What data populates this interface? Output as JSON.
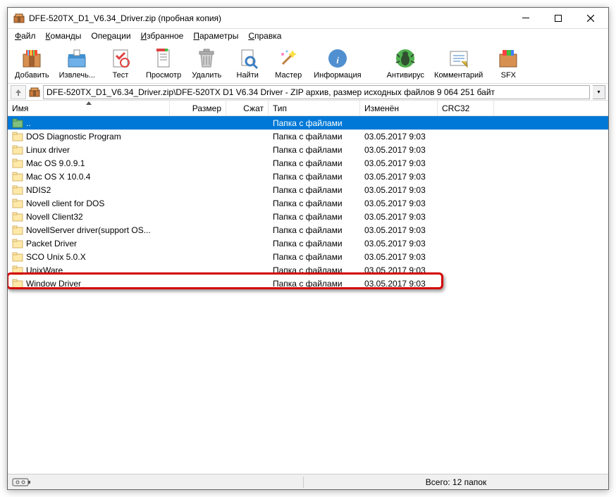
{
  "window": {
    "title": "DFE-520TX_D1_V6.34_Driver.zip (пробная копия)"
  },
  "menu": {
    "file": "Файл",
    "commands": "Команды",
    "operations": "Операции",
    "favorites": "Избранное",
    "parameters": "Параметры",
    "help": "Справка"
  },
  "toolbar": {
    "add": "Добавить",
    "extract": "Извлечь...",
    "test": "Тест",
    "view": "Просмотр",
    "delete": "Удалить",
    "find": "Найти",
    "wizard": "Мастер",
    "info": "Информация",
    "antivirus": "Антивирус",
    "comment": "Комментарий",
    "sfx": "SFX"
  },
  "path": "DFE-520TX_D1_V6.34_Driver.zip\\DFE-520TX D1 V6.34 Driver - ZIP архив, размер исходных файлов 9 064 251 байт",
  "columns": {
    "name": "Имя",
    "size": "Размер",
    "packed": "Сжат",
    "type": "Тип",
    "modified": "Изменён",
    "crc": "CRC32"
  },
  "rows": [
    {
      "name": "..",
      "type": "Папка с файлами",
      "date": "",
      "up": true
    },
    {
      "name": "DOS Diagnostic Program",
      "type": "Папка с файлами",
      "date": "03.05.2017 9:03"
    },
    {
      "name": "Linux driver",
      "type": "Папка с файлами",
      "date": "03.05.2017 9:03"
    },
    {
      "name": "Mac OS 9.0.9.1",
      "type": "Папка с файлами",
      "date": "03.05.2017 9:03"
    },
    {
      "name": "Mac OS X 10.0.4",
      "type": "Папка с файлами",
      "date": "03.05.2017 9:03"
    },
    {
      "name": "NDIS2",
      "type": "Папка с файлами",
      "date": "03.05.2017 9:03"
    },
    {
      "name": "Novell client for DOS",
      "type": "Папка с файлами",
      "date": "03.05.2017 9:03"
    },
    {
      "name": "Novell Client32",
      "type": "Папка с файлами",
      "date": "03.05.2017 9:03"
    },
    {
      "name": "NovellServer driver(support OS...",
      "type": "Папка с файлами",
      "date": "03.05.2017 9:03"
    },
    {
      "name": "Packet Driver",
      "type": "Папка с файлами",
      "date": "03.05.2017 9:03"
    },
    {
      "name": "SCO Unix 5.0.X",
      "type": "Папка с файлами",
      "date": "03.05.2017 9:03"
    },
    {
      "name": "UnixWare",
      "type": "Папка с файлами",
      "date": "03.05.2017 9:03"
    },
    {
      "name": "Window Driver",
      "type": "Папка с файлами",
      "date": "03.05.2017 9:03"
    }
  ],
  "status": "Всего: 12 папок"
}
